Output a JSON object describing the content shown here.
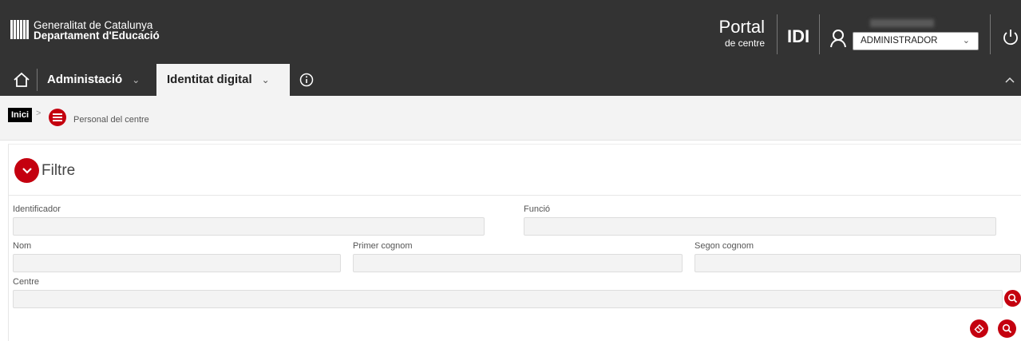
{
  "header": {
    "brand_line1": "Generalitat de Catalunya",
    "brand_line2": "Departament d'Educació",
    "portal_title": "Portal",
    "portal_subtitle": "de centre",
    "app_acronym": "IDI",
    "role_selected": "ADMINISTRADOR"
  },
  "nav": {
    "items": [
      {
        "label": "Administació"
      },
      {
        "label": "Identitat digital"
      }
    ]
  },
  "breadcrumb": {
    "home": "Inici",
    "separator": ">",
    "current": "Personal del centre"
  },
  "filter": {
    "title": "Filtre",
    "fields": {
      "identificador": {
        "label": "Identificador",
        "value": ""
      },
      "funcio": {
        "label": "Funció",
        "value": ""
      },
      "nom": {
        "label": "Nom",
        "value": ""
      },
      "primer_cognom": {
        "label": "Primer cognom",
        "value": ""
      },
      "segon_cognom": {
        "label": "Segon cognom",
        "value": ""
      },
      "centre": {
        "label": "Centre",
        "value": ""
      }
    }
  },
  "colors": {
    "header_bg": "#333333",
    "accent_red": "#c4000f",
    "breadcrumb_bg": "#f3f3f3",
    "input_bg": "#f3f3f3"
  },
  "icons": {
    "logo": "generalitat-logo-icon",
    "user": "user-icon",
    "power": "power-icon",
    "home": "home-icon",
    "info": "info-icon",
    "collapse": "chevron-up-icon",
    "breadcrumb_section": "list-icon",
    "filter_toggle": "chevron-down-icon",
    "lookup": "search-icon",
    "clear": "eraser-icon"
  }
}
